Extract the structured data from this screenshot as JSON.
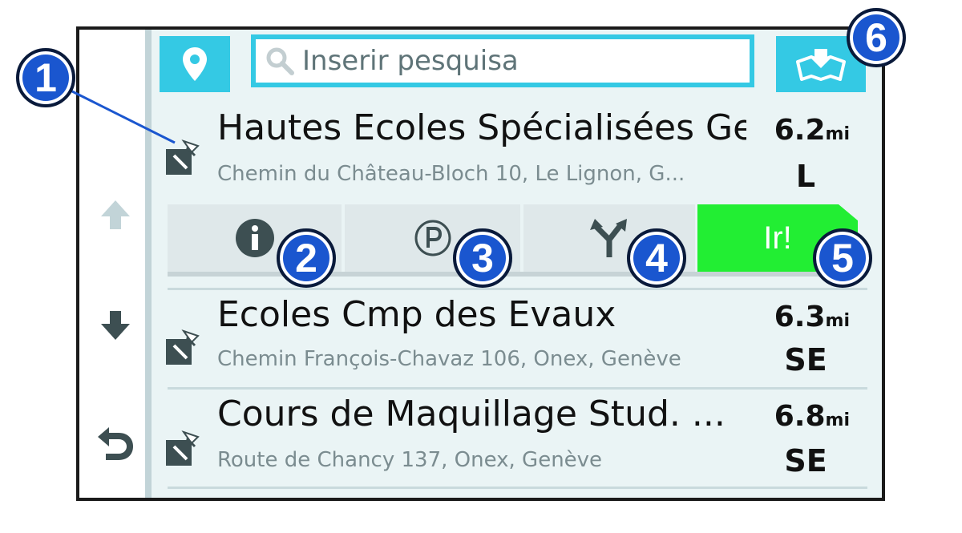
{
  "search": {
    "placeholder": "Inserir pesquisa"
  },
  "results": [
    {
      "name": "Hautes Ecoles Spécialisées Ge",
      "address": "Chemin du Château-Bloch 10, Le Lignon, G...",
      "distance": "6.2",
      "unit": "mi",
      "direction": "L"
    },
    {
      "name": "Ecoles Cmp des Evaux",
      "address": "Chemin François-Chavaz 106, Onex, Genève",
      "distance": "6.3",
      "unit": "mi",
      "direction": "SE"
    },
    {
      "name": "Cours de Maquillage Stud. ...",
      "address": "Route de Chancy 137, Onex, Genève",
      "distance": "6.8",
      "unit": "mi",
      "direction": "SE"
    }
  ],
  "actions": {
    "go_label": "Ir!"
  },
  "callouts": [
    "1",
    "2",
    "3",
    "4",
    "5",
    "6"
  ],
  "icons": {
    "location": "map-pin-icon",
    "search": "magnifier-icon",
    "map": "map-view-icon",
    "result": "school-poi-icon",
    "info": "info-icon",
    "parking": "parking-icon",
    "routes": "route-split-icon",
    "scroll_up": "arrow-up-icon",
    "scroll_down": "arrow-down-icon",
    "back": "back-icon"
  },
  "colors": {
    "accent": "#34c9e4",
    "go": "#22ee33",
    "callout": "#1a56cf"
  }
}
